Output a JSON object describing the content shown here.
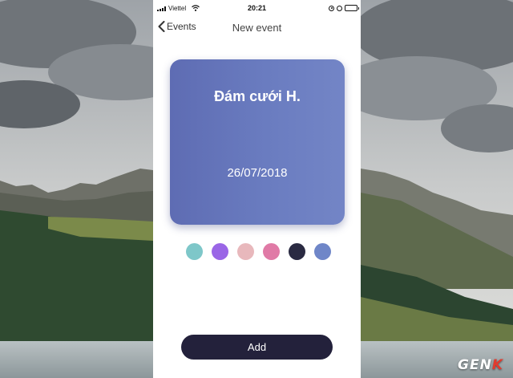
{
  "status_bar": {
    "carrier": "Viettel",
    "time": "20:21"
  },
  "nav": {
    "back_label": "Events",
    "title": "New event"
  },
  "event": {
    "name": "Đám cưới H.",
    "date": "26/07/2018",
    "card_color": "#6a7cc0"
  },
  "color_options": [
    "#7ec7c9",
    "#9a66e6",
    "#e8b8bc",
    "#e07aa6",
    "#2a2a42",
    "#6f86c8"
  ],
  "actions": {
    "add_label": "Add"
  },
  "watermark": {
    "text_main": "GEN",
    "text_accent": "K"
  }
}
